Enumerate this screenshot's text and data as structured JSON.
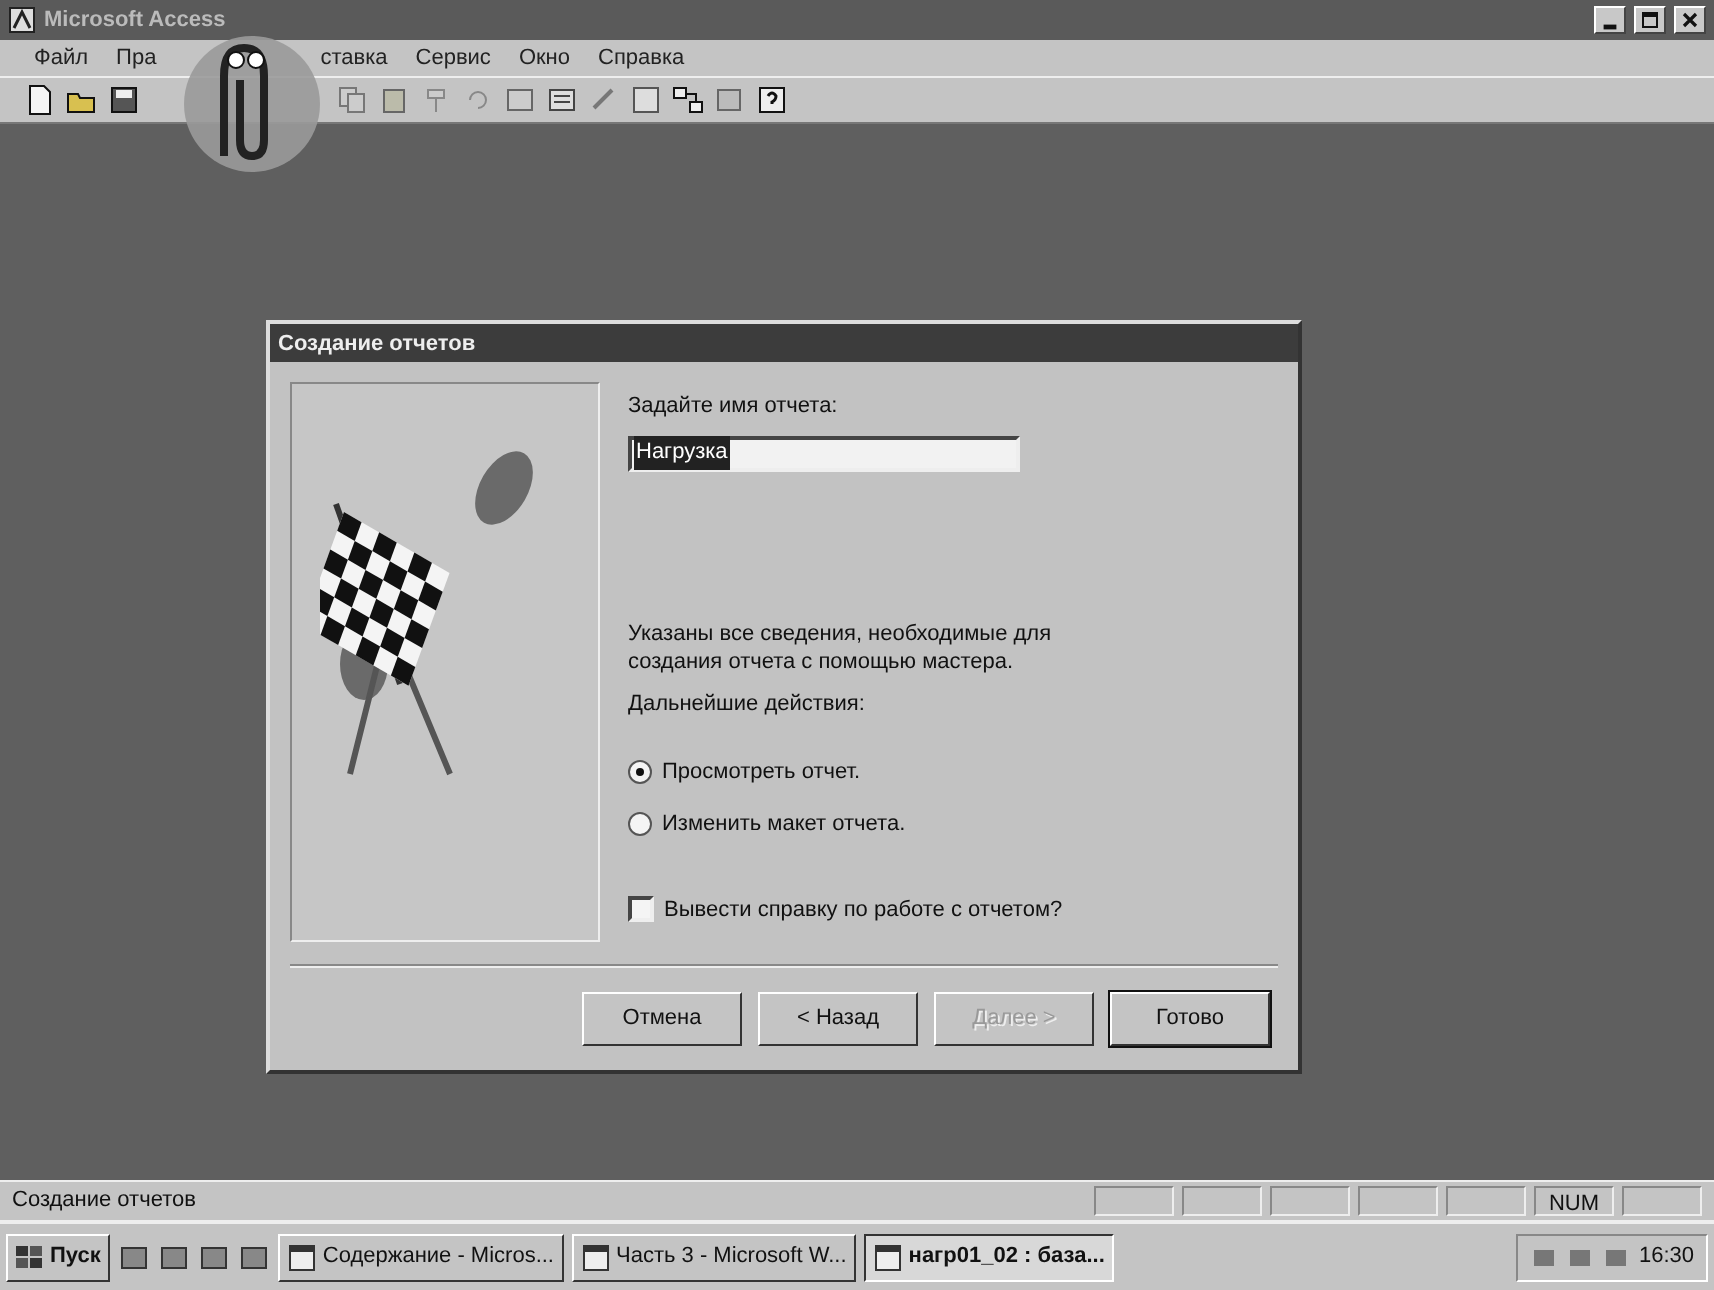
{
  "window": {
    "title": "Microsoft Access"
  },
  "menu": [
    "Файл",
    "Пра",
    "ставка",
    "Сервис",
    "Окно",
    "Справка"
  ],
  "dialog": {
    "title": "Создание отчетов",
    "name_label": "Задайте имя отчета:",
    "name_value": "Нагрузка",
    "info": "Указаны все сведения, необходимые для создания отчета с помощью мастера.",
    "next_label": "Дальнейшие действия:",
    "options": [
      {
        "label": "Просмотреть отчет.",
        "selected": true
      },
      {
        "label": "Изменить макет отчета.",
        "selected": false
      }
    ],
    "help_checkbox": {
      "label": "Вывести справку по работе с отчетом?",
      "checked": false
    },
    "buttons": [
      {
        "label": "Отмена",
        "disabled": false,
        "default": false
      },
      {
        "label": "< Назад",
        "disabled": false,
        "default": false
      },
      {
        "label": "Далее >",
        "disabled": true,
        "default": false
      },
      {
        "label": "Готово",
        "disabled": false,
        "default": true
      }
    ]
  },
  "status_bar": {
    "text": "Создание отчетов",
    "indicator": "NUM"
  },
  "taskbar": {
    "start": "Пуск",
    "tasks": [
      {
        "label": "Содержание - Micros...",
        "selected": false
      },
      {
        "label": "Часть 3 - Microsoft W...",
        "selected": false
      },
      {
        "label": "нагр01_02 : база...",
        "selected": true
      }
    ],
    "clock": "16:30"
  }
}
